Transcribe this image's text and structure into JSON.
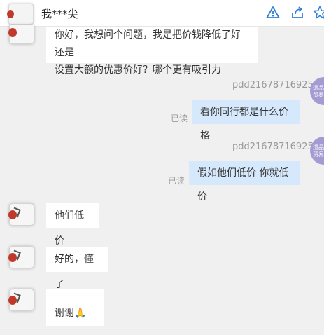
{
  "header": {
    "title": "我***尖"
  },
  "messages": {
    "m1": {
      "line1": "你好，我想问个问题，我是把价钱降低了好还是",
      "line2": "设置大额的优惠价好？哪个更有吸引力"
    },
    "m2": {
      "sender": "pdd21678716925",
      "read": "已读",
      "text": "看你同行都是什么价格",
      "avatar_text": "遗品\n贸易"
    },
    "m3": {
      "sender": "pdd21678716925",
      "read": "已读",
      "text": "假如他们低价 你就低价",
      "avatar_text": "遗品\n贸易"
    },
    "m4": {
      "text": "他们低价"
    },
    "m5": {
      "text": "好的，懂了"
    },
    "m6": {
      "text": "谢谢🙏"
    }
  },
  "icons": [
    "alert-icon",
    "share-icon",
    "star-icon"
  ],
  "colors": {
    "outgoing_bubble": "#d6e8fb",
    "incoming_bubble": "#ffffff",
    "accent": "#2f7fd6",
    "agent_avatar": "#a49bd3"
  }
}
